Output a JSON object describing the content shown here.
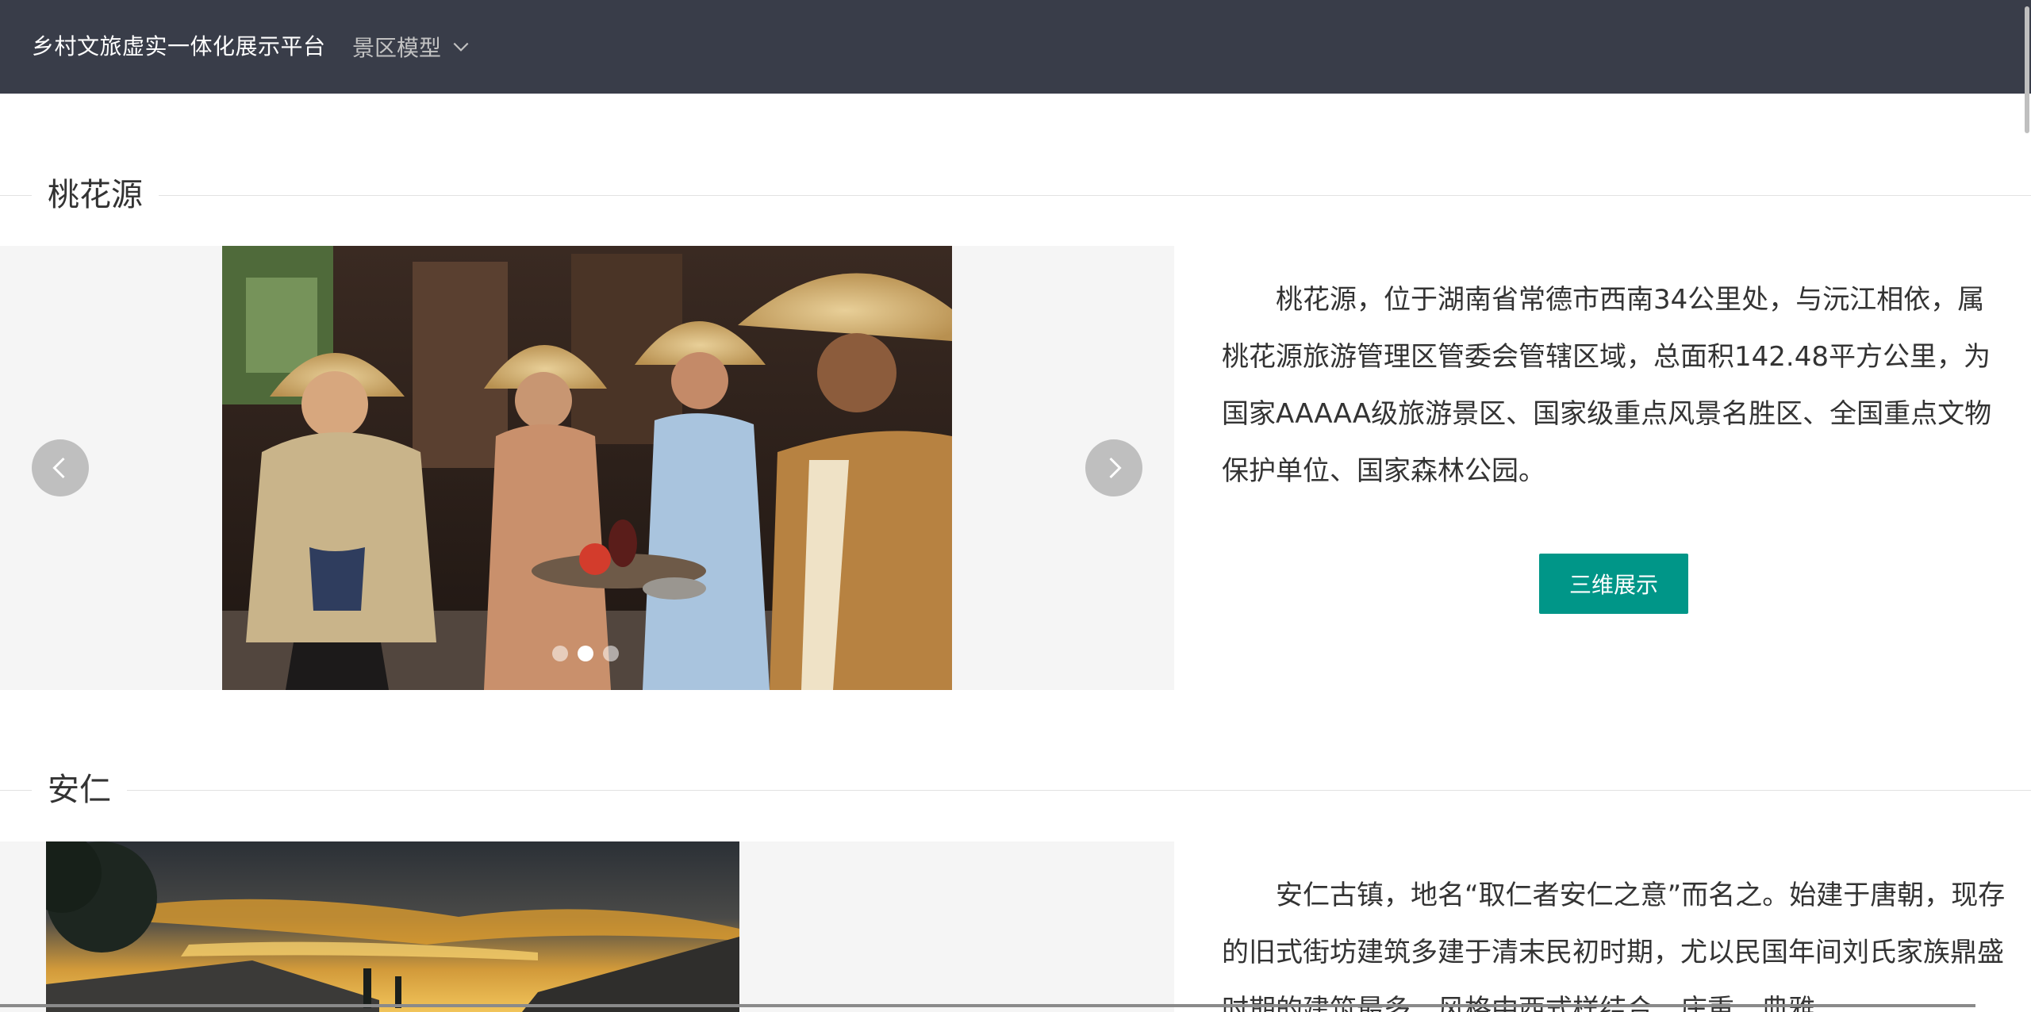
{
  "header": {
    "brand": "乡村文旅虚实一体化展示平台",
    "menu_label": "景区模型",
    "menu_icon": "chevron-down-icon"
  },
  "sections": [
    {
      "title": "桃花源",
      "description": "桃花源，位于湖南省常德市西南34公里处，与沅江相依，属桃花源旅游管理区管委会管辖区域，总面积142.48平方公里，为国家AAAAA级旅游景区、国家级重点风景名胜区、全国重点文物保护单位、国家森林公园。",
      "button_label": "三维展示",
      "carousel": {
        "slide_count": 3,
        "active_index": 1,
        "prev_icon": "chevron-left-icon",
        "next_icon": "chevron-right-icon"
      }
    },
    {
      "title": "安仁",
      "description": "安仁古镇，地名“取仁者安仁之意”而名之。始建于唐朝，现存的旧式街坊建筑多建于清末民初时期，尤以民国年间刘氏家族鼎盛时期的建筑最多，风格中西式样结合，庄重、典雅"
    }
  ],
  "colors": {
    "header_bg": "#393d49",
    "accent": "#009688",
    "carousel_bg": "#f5f5f5"
  }
}
